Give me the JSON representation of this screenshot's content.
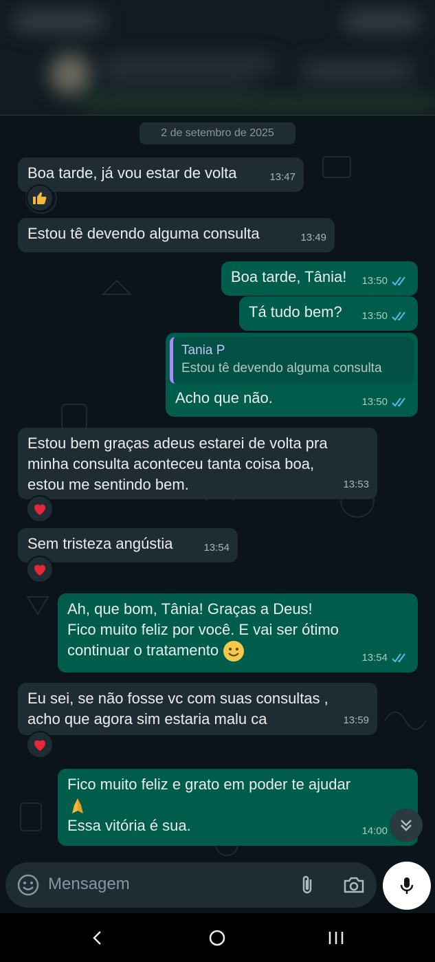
{
  "date_chip": "2 de setembro de 2025",
  "messages": [
    {
      "text": "Boa tarde, já vou estar de volta",
      "time": "13:47",
      "reaction": "thumbs-up"
    },
    {
      "text": "Estou tê devendo alguma consulta",
      "time": "13:49"
    },
    {
      "text": "Boa tarde, Tânia!",
      "time": "13:50"
    },
    {
      "text": "Tá tudo bem?",
      "time": "13:50"
    },
    {
      "quote_name": "Tania P",
      "quote_text": "Estou tê devendo alguma consulta",
      "text": "Acho que não.",
      "time": "13:50"
    },
    {
      "text": "Estou bem graças adeus estarei de volta pra\nminha consulta aconteceu tanta coisa boa,\nestou me sentindo bem.",
      "time": "13:53",
      "reaction": "heart"
    },
    {
      "text": "Sem tristeza angústia",
      "time": "13:54",
      "reaction": "heart"
    },
    {
      "text": "Ah, que bom, Tânia! Graças a Deus!\nFico muito feliz por você. E vai ser ótimo\ncontinuar o tratamento",
      "time": "13:54"
    },
    {
      "text": "Eu sei, se não fosse vc com suas consultas ,\nacho que agora sim estaria malu ca",
      "time": "13:59",
      "reaction": "heart"
    },
    {
      "text": "Fico muito feliz e grato em poder te ajudar\n\nEssa vitória é sua.",
      "time": "14:00"
    }
  ],
  "input": {
    "placeholder": "Mensagem"
  },
  "colors": {
    "incoming": "#202c33",
    "outgoing": "#005c4b",
    "background": "#0b141a",
    "read_ticks": "#53bdeb"
  }
}
